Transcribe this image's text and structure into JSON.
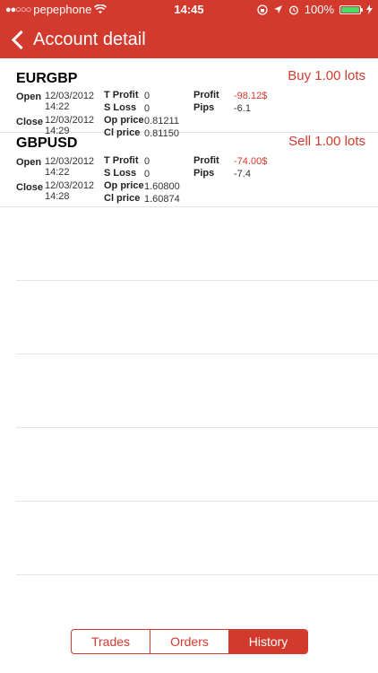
{
  "status_bar": {
    "carrier": "pepephone",
    "time": "14:45",
    "battery": "100%"
  },
  "nav": {
    "title": "Account detail"
  },
  "trades": [
    {
      "symbol": "EURGBP",
      "side": "Buy 1.00 lots",
      "open_label": "Open",
      "open_date": "12/03/2012",
      "open_time": "14:22",
      "close_label": "Close",
      "close_date": "12/03/2012",
      "close_time": "14:29",
      "tprofit_label": "T Profit",
      "tprofit": "0",
      "sloss_label": "S Loss",
      "sloss": "0",
      "opprice_label": "Op price",
      "opprice": "0.81211",
      "clprice_label": "Cl price",
      "clprice": "0.81150",
      "profit_label": "Profit",
      "profit": "-98.12$",
      "pips_label": "Pips",
      "pips": "-6.1"
    },
    {
      "symbol": "GBPUSD",
      "side": "Sell 1.00 lots",
      "open_label": "Open",
      "open_date": "12/03/2012",
      "open_time": "14:22",
      "close_label": "Close",
      "close_date": "12/03/2012",
      "close_time": "14:28",
      "tprofit_label": "T Profit",
      "tprofit": "0",
      "sloss_label": "S Loss",
      "sloss": "0",
      "opprice_label": "Op price",
      "opprice": "1.60800",
      "clprice_label": "Cl price",
      "clprice": "1.60874",
      "profit_label": "Profit",
      "profit": "-74.00$",
      "pips_label": "Pips",
      "pips": "-7.4"
    }
  ],
  "tabs": [
    {
      "label": "Trades",
      "active": false
    },
    {
      "label": "Orders",
      "active": false
    },
    {
      "label": "History",
      "active": true
    }
  ],
  "colors": {
    "accent": "#d23a2e",
    "battery": "#4cd964"
  }
}
